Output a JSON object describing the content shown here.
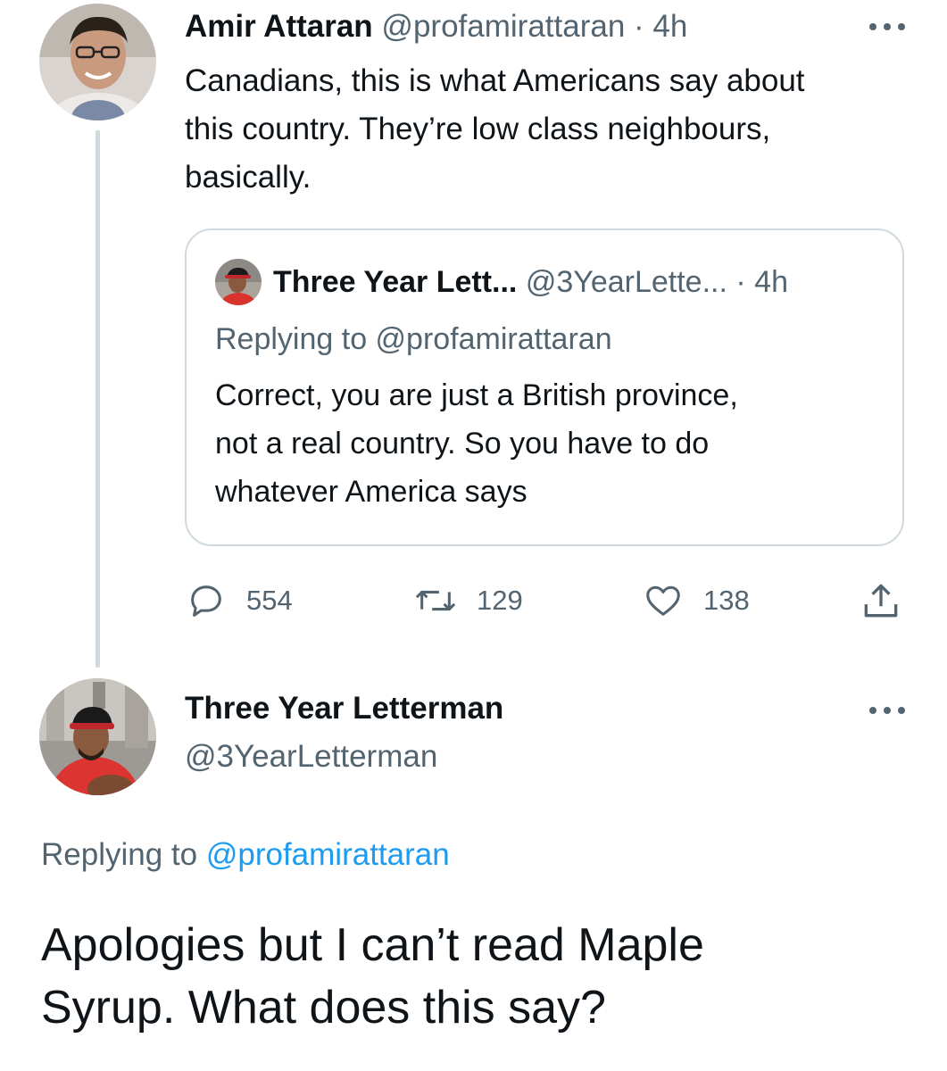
{
  "original_tweet": {
    "name": "Amir Attaran",
    "handle": "@profamirattaran",
    "separator": "·",
    "time": "4h",
    "text": "Canadians, this is what Americans say about\nthis country.  They’re low class neighbours,\nbasically.",
    "quoted_tweet": {
      "name": "Three Year Lett...",
      "handle": "@3YearLette...",
      "separator": "·",
      "time": "4h",
      "replying_to": "Replying to @profamirattaran",
      "text": "Correct, you are just a British province,\nnot a real country. So you have to do\nwhatever America says"
    },
    "actions": {
      "replies": "554",
      "retweets": "129",
      "likes": "138"
    }
  },
  "reply_tweet": {
    "name": "Three Year Letterman",
    "handle": "@3YearLetterman",
    "replying_prefix": "Replying to",
    "replying_handle": "@profamirattaran",
    "text": "Apologies but I can’t read Maple\nSyrup. What does this say?"
  },
  "colors": {
    "text": "#0f1419",
    "muted": "#536471",
    "link": "#1d9bf0",
    "border": "#cfd9de"
  },
  "icons": {
    "more": "more-horizontal-icon",
    "reply": "reply-bubble-icon",
    "retweet": "retweet-icon",
    "like": "heart-icon",
    "share": "share-icon"
  }
}
